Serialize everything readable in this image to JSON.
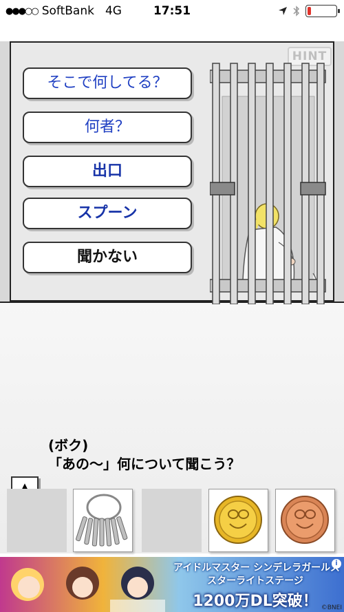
{
  "status_bar": {
    "signal": "●●●○○",
    "carrier": "SoftBank",
    "network": "4G",
    "time": "17:51",
    "battery_level": 0.12
  },
  "hint_button": {
    "label": "HINT"
  },
  "choices": [
    {
      "label": "そこで何してる？"
    },
    {
      "label": "何者？"
    },
    {
      "label": "出口"
    },
    {
      "label": "スプーン"
    },
    {
      "label": "聞かない"
    }
  ],
  "dialog": {
    "speaker": "(ボク)",
    "text": "「あの～」何について聞こう？"
  },
  "nav": {
    "up_arrow": "▲"
  },
  "inventory": {
    "slots": [
      {
        "item": "empty"
      },
      {
        "item": "key-ring-icon"
      },
      {
        "item": "empty"
      },
      {
        "item": "gold-coin-icon"
      },
      {
        "item": "copper-coin-icon"
      }
    ]
  },
  "ad": {
    "title_line1": "アイドルマスター シンデレラガールズ",
    "title_line2": "スターライトステージ",
    "headline": "1200万DL突破！",
    "info": "i",
    "copyright": "©BNEI"
  },
  "colors": {
    "choice_blue": "#1f3fc2",
    "battery_low": "#e0332b"
  }
}
